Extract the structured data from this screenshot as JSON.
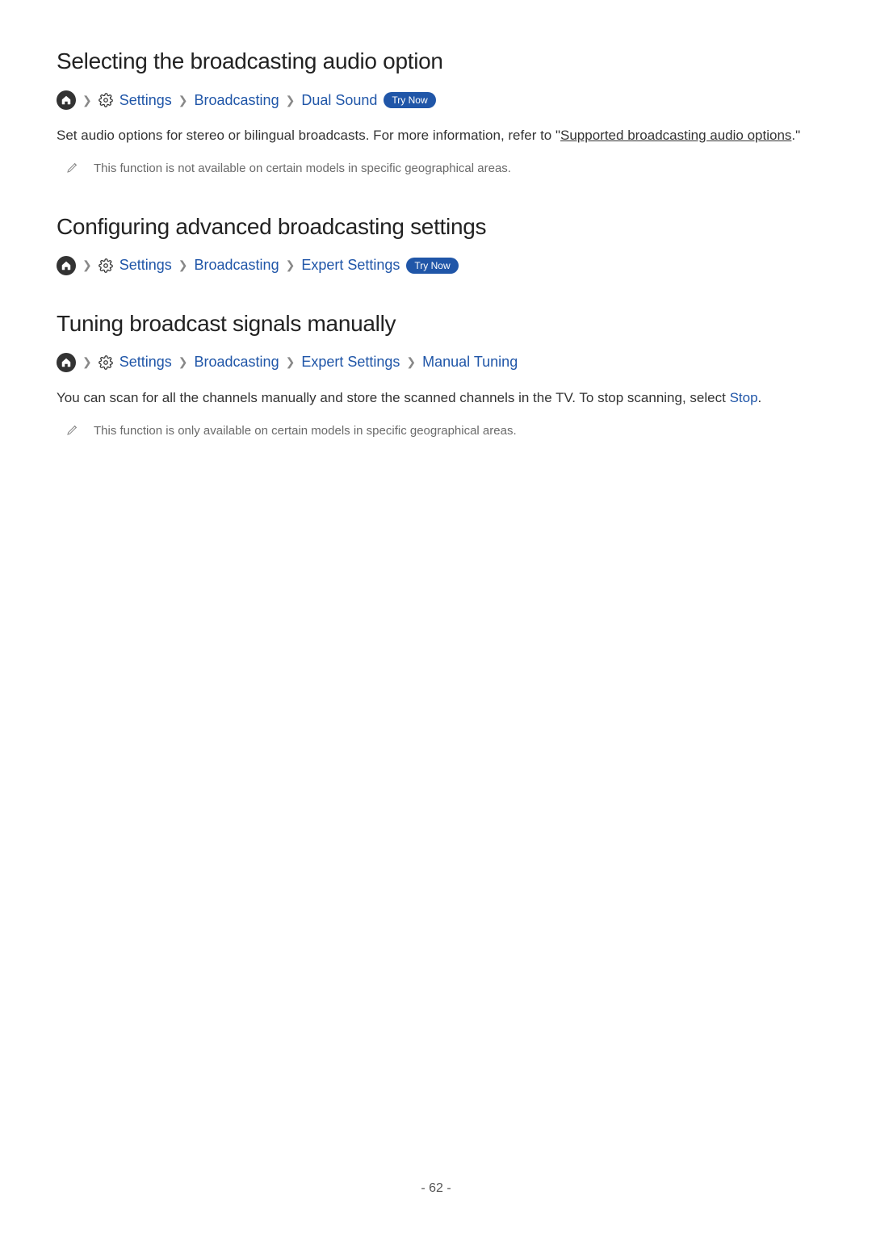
{
  "sections": [
    {
      "heading": "Selecting the broadcasting audio option",
      "breadcrumbs": [
        {
          "label": "Settings",
          "withGear": true
        },
        {
          "label": "Broadcasting"
        },
        {
          "label": "Dual Sound"
        }
      ],
      "tryNow": "Try Now",
      "body_pre": "Set audio options for stereo or bilingual broadcasts. For more information, refer to \"",
      "body_link": "Supported broadcasting audio options",
      "body_post": ".\"",
      "note": "This function is not available on certain models in specific geographical areas."
    },
    {
      "heading": "Configuring advanced broadcasting settings",
      "breadcrumbs": [
        {
          "label": "Settings",
          "withGear": true
        },
        {
          "label": "Broadcasting"
        },
        {
          "label": "Expert Settings"
        }
      ],
      "tryNow": "Try Now"
    },
    {
      "heading": "Tuning broadcast signals manually",
      "breadcrumbs": [
        {
          "label": "Settings",
          "withGear": true
        },
        {
          "label": "Broadcasting"
        },
        {
          "label": "Expert Settings"
        },
        {
          "label": "Manual Tuning"
        }
      ],
      "body_pre": "You can scan for all the channels manually and store the scanned channels in the TV. To stop scanning, select ",
      "body_inline": "Stop",
      "body_post": ".",
      "note": "This function is only available on certain models in specific geographical areas."
    }
  ],
  "pageNumber": "- 62 -"
}
